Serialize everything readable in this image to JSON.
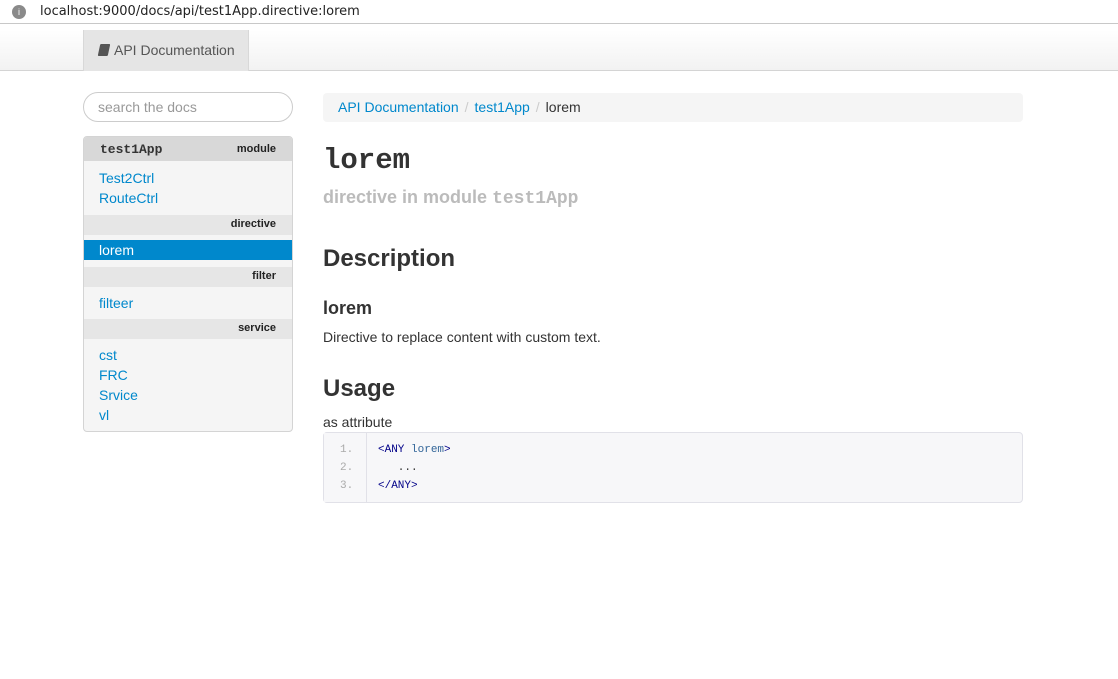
{
  "browser": {
    "url": "localhost:9000/docs/api/test1App.directive:lorem"
  },
  "navbar": {
    "brand_label": "API Documentation"
  },
  "search": {
    "placeholder": "search the docs"
  },
  "sidebar": {
    "module_name": "test1App",
    "module_type": "module",
    "controllers": [
      "Test2Ctrl",
      "RouteCtrl"
    ],
    "sections": {
      "directive": "directive",
      "filter": "filter",
      "service": "service"
    },
    "directives": [
      "lorem"
    ],
    "filters": [
      "filteer"
    ],
    "services": [
      "cst",
      "FRC",
      "Srvice",
      "vl"
    ],
    "active_item": "lorem"
  },
  "breadcrumb": {
    "items": [
      "API Documentation",
      "test1App"
    ],
    "current": "lorem"
  },
  "page": {
    "title": "lorem",
    "subtitle_prefix": "directive in module",
    "subtitle_module": "test1App",
    "description_heading": "Description",
    "item_heading": "lorem",
    "description_text": "Directive to replace content with custom text.",
    "usage_heading": "Usage",
    "usage_as": "as attribute"
  },
  "code": {
    "line_numbers": [
      "1.",
      "2.",
      "3."
    ],
    "lines": [
      {
        "open": "<ANY",
        "attr": "lorem",
        "close": ">"
      },
      {
        "text": "   ..."
      },
      {
        "text": "</ANY>"
      }
    ]
  }
}
